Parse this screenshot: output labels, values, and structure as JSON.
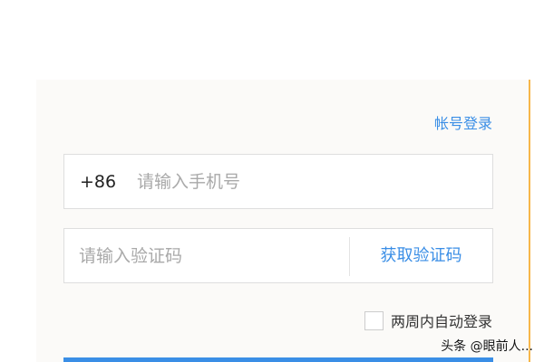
{
  "login": {
    "account_login_link": "帐号登录",
    "country_code": "+86",
    "phone_placeholder": "请输入手机号",
    "code_placeholder": "请输入验证码",
    "get_code_button": "获取验证码",
    "remember_label": "两周内自动登录"
  },
  "watermark": "头条 @眼前人..."
}
